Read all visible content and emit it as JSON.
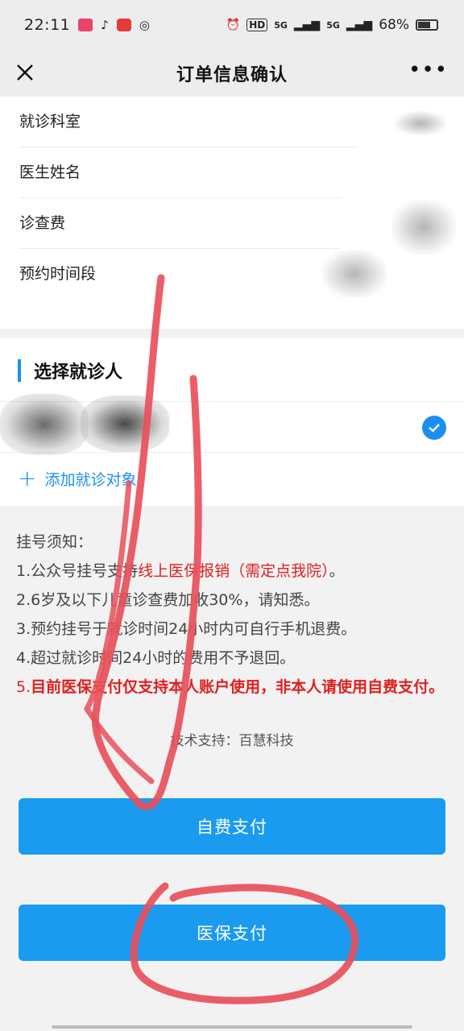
{
  "status_bar": {
    "time": "22:11",
    "network_1": "5G",
    "network_2": "5G",
    "battery": "68%",
    "battery_level": 0.68
  },
  "header": {
    "title": "订单信息确认",
    "more": "•••"
  },
  "order_info": {
    "rows": [
      {
        "label": "就诊科室"
      },
      {
        "label": "医生姓名"
      },
      {
        "label": "诊查费"
      },
      {
        "label": "预约时间段"
      }
    ]
  },
  "patient": {
    "section_title": "选择就诊人",
    "add_label": "添加就诊对象",
    "selected": true
  },
  "notice": {
    "title": "挂号须知：",
    "item1_prefix": "1.公众号挂号支持",
    "item1_highlight": "线上医保报销（需定点我院）",
    "item1_suffix": "。",
    "item2": "2.6岁及以下儿童诊查费加收30%，请知悉。",
    "item3": "3.预约挂号于就诊时间24小时内可自行手机退费。",
    "item4": "4.超过就诊时间24小时的费用不予退回。",
    "item5_prefix": "5.",
    "item5_highlight": "目前医保支付仅支持本人账户使用，非本人请使用自费支付。"
  },
  "tech_support": "技术支持：百慧科技",
  "buttons": {
    "self_pay": "自费支付",
    "insurance_pay": "医保支付"
  },
  "colors": {
    "accent": "#1a9bf0",
    "warning": "#e01f1f",
    "annotation": "#e8505b"
  }
}
